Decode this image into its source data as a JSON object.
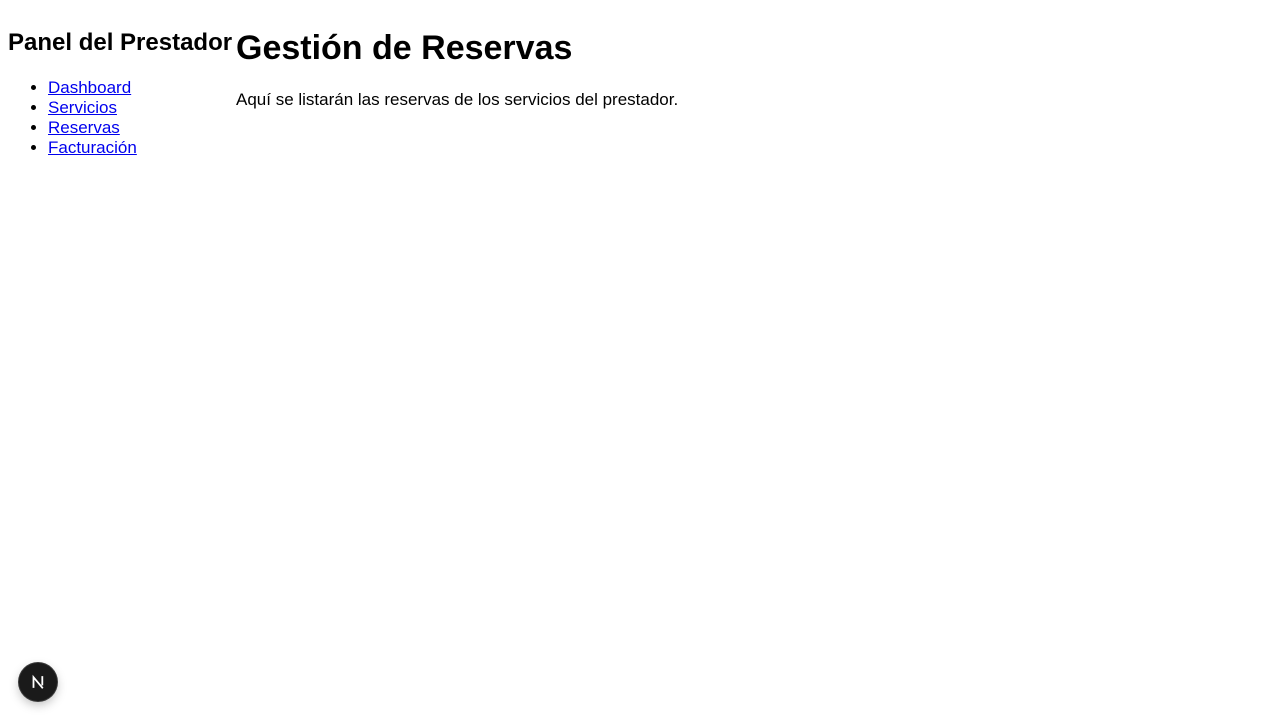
{
  "sidebar": {
    "title": "Panel del Prestador",
    "items": [
      {
        "label": "Dashboard"
      },
      {
        "label": "Servicios"
      },
      {
        "label": "Reservas"
      },
      {
        "label": "Facturación"
      }
    ]
  },
  "main": {
    "title": "Gestión de Reservas",
    "description": "Aquí se listarán las reservas de los servicios del prestador."
  },
  "devtools": {
    "icon": "nextjs-icon",
    "letter": "N"
  },
  "colors": {
    "link": "#0000ee",
    "text": "#000000",
    "background": "#ffffff",
    "badge": "#1a1a1a"
  }
}
